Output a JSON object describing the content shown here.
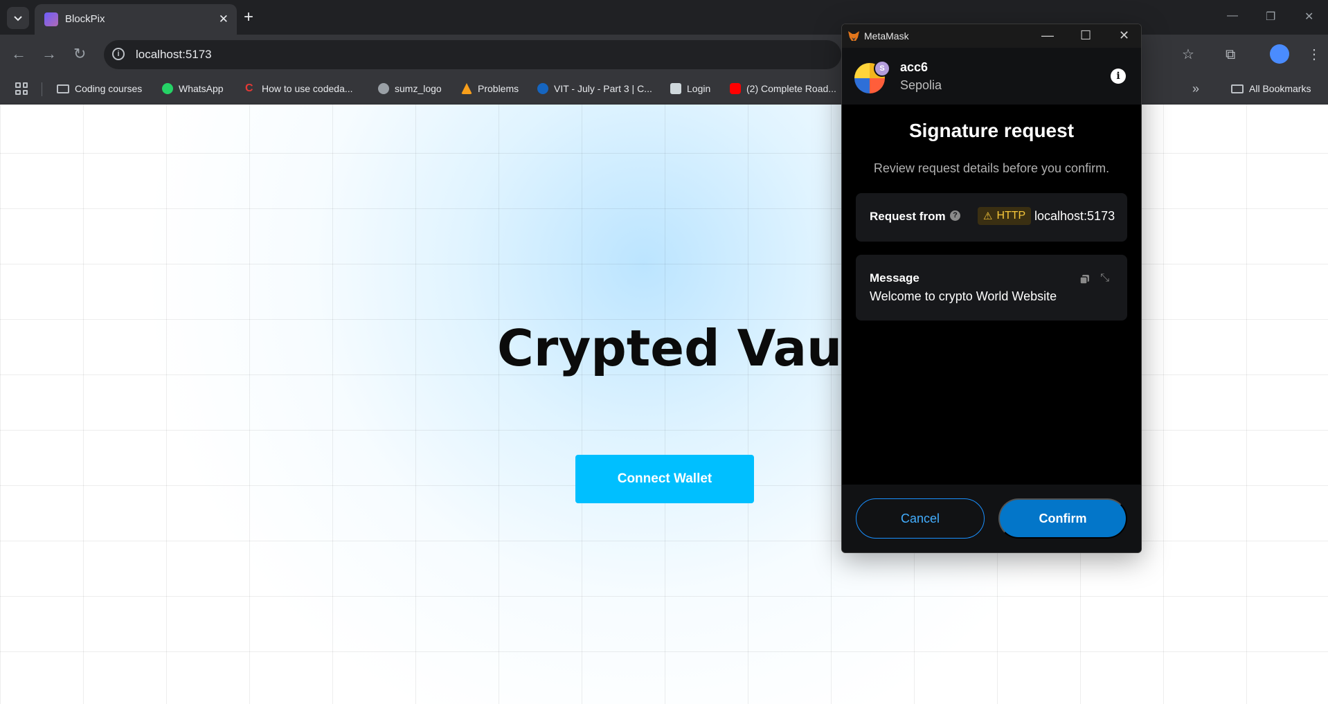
{
  "browser": {
    "tab": {
      "title": "BlockPix"
    },
    "address": {
      "url": "localhost:5173"
    },
    "bookmarks": [
      {
        "label": "Coding courses",
        "icon": "folder-icon",
        "color": "#bdc1c6"
      },
      {
        "label": "WhatsApp",
        "icon": "whatsapp-icon",
        "color": "#25d366"
      },
      {
        "label": "How to use codeda...",
        "icon": "codedamn-icon",
        "color": "#e53935"
      },
      {
        "label": "sumz_logo",
        "icon": "globe-icon",
        "color": "#bdc1c6"
      },
      {
        "label": "Problems",
        "icon": "leetcode-icon",
        "color": "#f89f1b"
      },
      {
        "label": "VIT - July - Part 3 | C...",
        "icon": "coursera-icon",
        "color": "#1565c0"
      },
      {
        "label": "Login",
        "icon": "page-icon",
        "color": "#cfd8dc"
      },
      {
        "label": "(2) Complete Road...",
        "icon": "youtube-icon",
        "color": "#ff0000"
      }
    ],
    "all_bookmarks": "All Bookmarks"
  },
  "page": {
    "title": "Crypted Vault",
    "connect_label": "Connect Wallet",
    "accent_color": "#00bfff"
  },
  "metamask": {
    "window_title": "MetaMask",
    "account": "acc6",
    "network": "Sepolia",
    "avatar_badge": "S",
    "heading": "Signature request",
    "subheading": "Review request details before you confirm.",
    "request_from_label": "Request from",
    "http_badge": "HTTP",
    "origin": "localhost:5173",
    "message_label": "Message",
    "message_text": "Welcome to crypto World Website",
    "cancel_label": "Cancel",
    "confirm_label": "Confirm",
    "confirm_color": "#0376c9"
  }
}
